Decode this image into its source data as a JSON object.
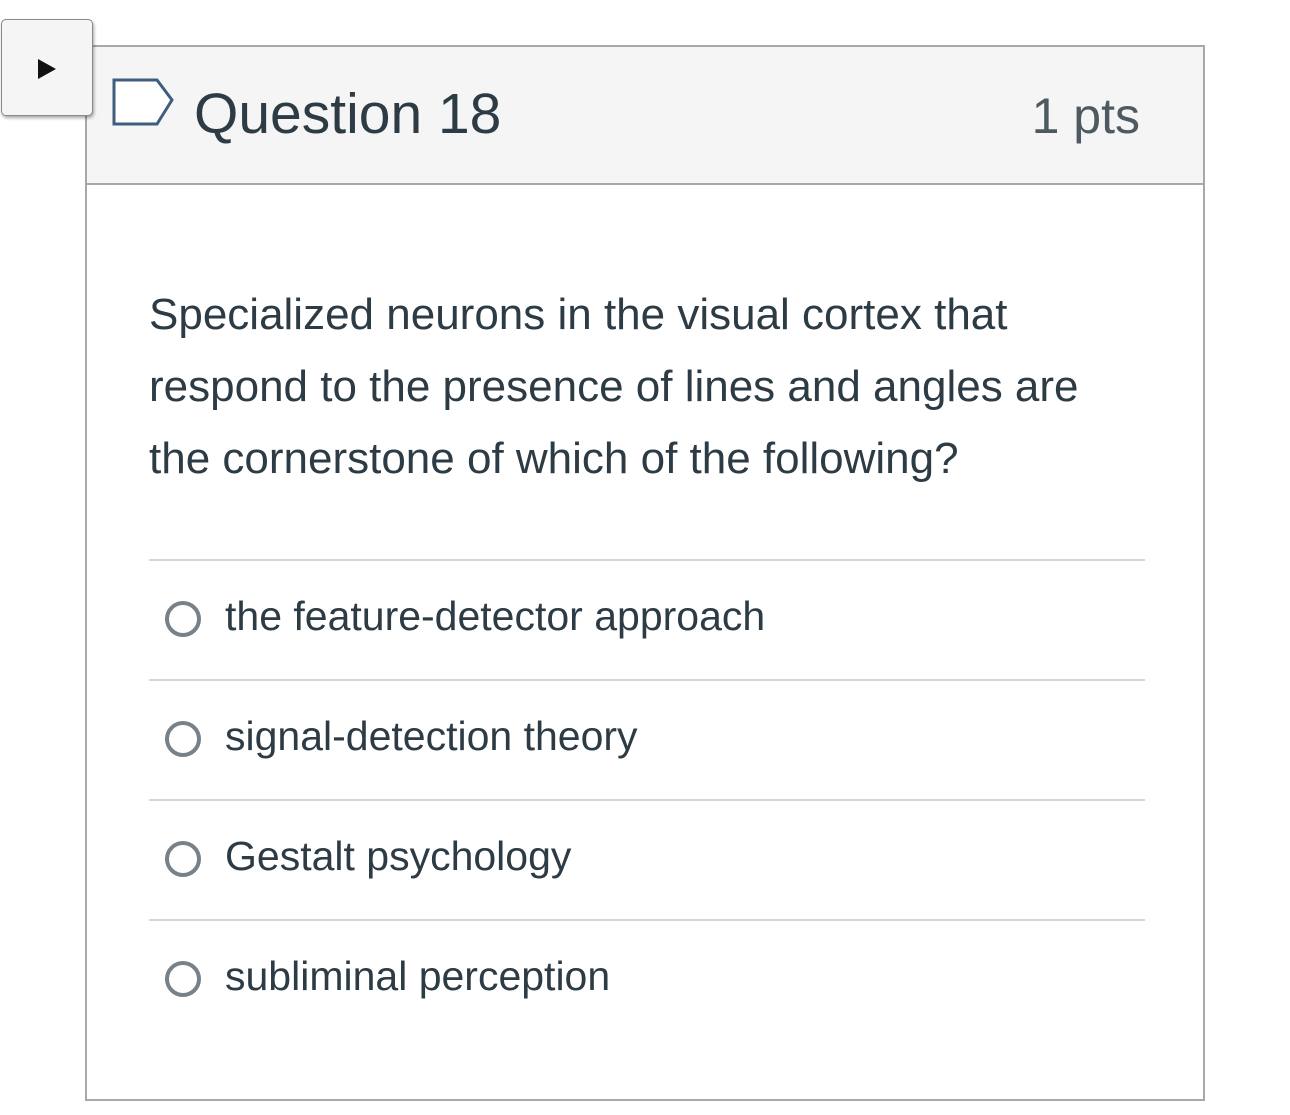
{
  "toggle": {
    "icon": "play-triangle-icon"
  },
  "question": {
    "title": "Question 18",
    "points": "1 pts",
    "flag_icon": "flag-outline-icon",
    "text": "Specialized neurons in the visual cortex that respond to the presence of lines and angles are the cornerstone of which of the following?",
    "answers": [
      {
        "label": "the feature-detector approach",
        "selected": false
      },
      {
        "label": "signal-detection theory",
        "selected": false
      },
      {
        "label": "Gestalt psychology",
        "selected": false
      },
      {
        "label": "subliminal perception",
        "selected": false
      }
    ]
  },
  "colors": {
    "header_bg": "#f5f5f5",
    "border": "#a8a8a8",
    "text": "#2d3b45",
    "flag_stroke": "#3f5e7e",
    "radio_border": "#77818a"
  }
}
